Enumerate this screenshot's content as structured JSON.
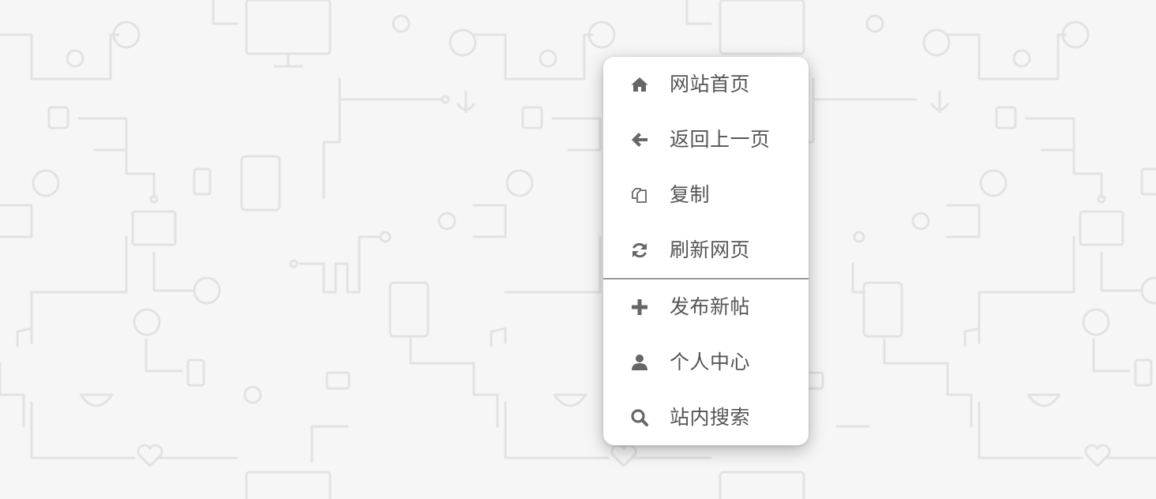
{
  "colors": {
    "background": "#f6f6f6",
    "pattern_stroke": "#e2e2e2",
    "menu_background": "#ffffff",
    "menu_text": "#555555",
    "menu_icon": "#666666",
    "divider": "#9a9a9a"
  },
  "context_menu": {
    "group_primary": [
      {
        "id": "home",
        "label": "网站首页",
        "icon": "home-icon"
      },
      {
        "id": "back",
        "label": "返回上一页",
        "icon": "arrow-left-icon"
      },
      {
        "id": "copy",
        "label": "复制",
        "icon": "copy-icon"
      },
      {
        "id": "refresh",
        "label": "刷新网页",
        "icon": "refresh-icon"
      }
    ],
    "group_secondary": [
      {
        "id": "new-post",
        "label": "发布新帖",
        "icon": "plus-icon"
      },
      {
        "id": "profile",
        "label": "个人中心",
        "icon": "user-icon"
      },
      {
        "id": "search",
        "label": "站内搜索",
        "icon": "search-icon"
      }
    ]
  }
}
